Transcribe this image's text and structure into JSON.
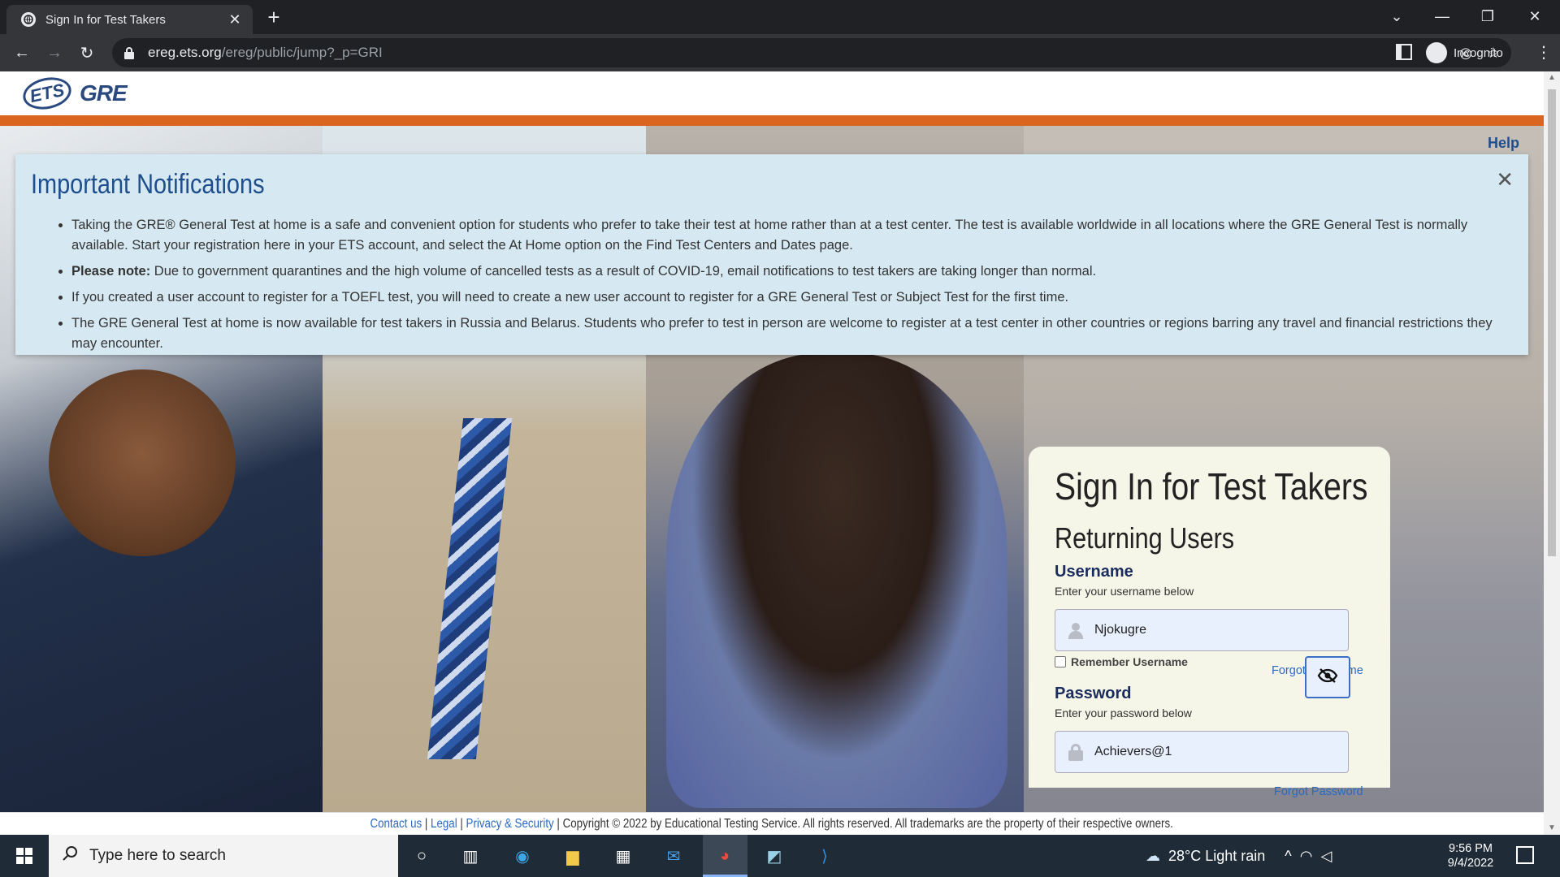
{
  "browser": {
    "tab_title": "Sign In for Test Takers",
    "url_host": "ereg.ets.org",
    "url_path": "/ereg/public/jump?_p=GRI",
    "profile_label": "Incognito"
  },
  "site": {
    "logo_ets": "ETS",
    "logo_gre": "GRE",
    "help_label": "Help"
  },
  "notifications": {
    "title": "Important Notifications",
    "close_label": "✕",
    "items": [
      {
        "bold": "",
        "text": "Taking the GRE® General Test at home is a safe and convenient option for students who prefer to take their test at home rather than at a test center. The test is available worldwide in all locations where the GRE General Test is normally available. Start your registration here in your ETS account, and select the At Home option on the Find Test Centers and Dates page."
      },
      {
        "bold": "Please note:",
        "text": " Due to government quarantines and the high volume of cancelled tests as a result of COVID-19, email notifications to test takers are taking longer than normal."
      },
      {
        "bold": "",
        "text": "If you created a user account to register for a TOEFL test, you will need to create a new user account to register for a GRE General Test or Subject Test for the first time."
      },
      {
        "bold": "",
        "text": "The GRE General Test at home is now available for test takers in Russia and Belarus. Students who prefer to test in person are welcome to register at a test center in other countries or regions barring any travel and financial restrictions they may encounter."
      }
    ]
  },
  "signin": {
    "title": "Sign In for Test Takers",
    "subtitle": "Returning Users",
    "username_label": "Username",
    "username_hint": "Enter your username below",
    "username_value": "Njokugre",
    "remember_label": "Remember Username",
    "forgot_username": "Forgot Username",
    "password_label": "Password",
    "password_hint": "Enter your password below",
    "password_value": "Achievers@1",
    "forgot_password": "Forgot Password"
  },
  "footer": {
    "contact": "Contact us",
    "legal": "Legal",
    "privacy": "Privacy & Security",
    "copyright": "Copyright © 2022 by Educational Testing Service. All rights reserved. All trademarks are the property of their respective owners."
  },
  "taskbar": {
    "search_placeholder": "Type here to search",
    "weather": "28°C  Light rain",
    "time": "9:56 PM",
    "date": "9/4/2022"
  }
}
